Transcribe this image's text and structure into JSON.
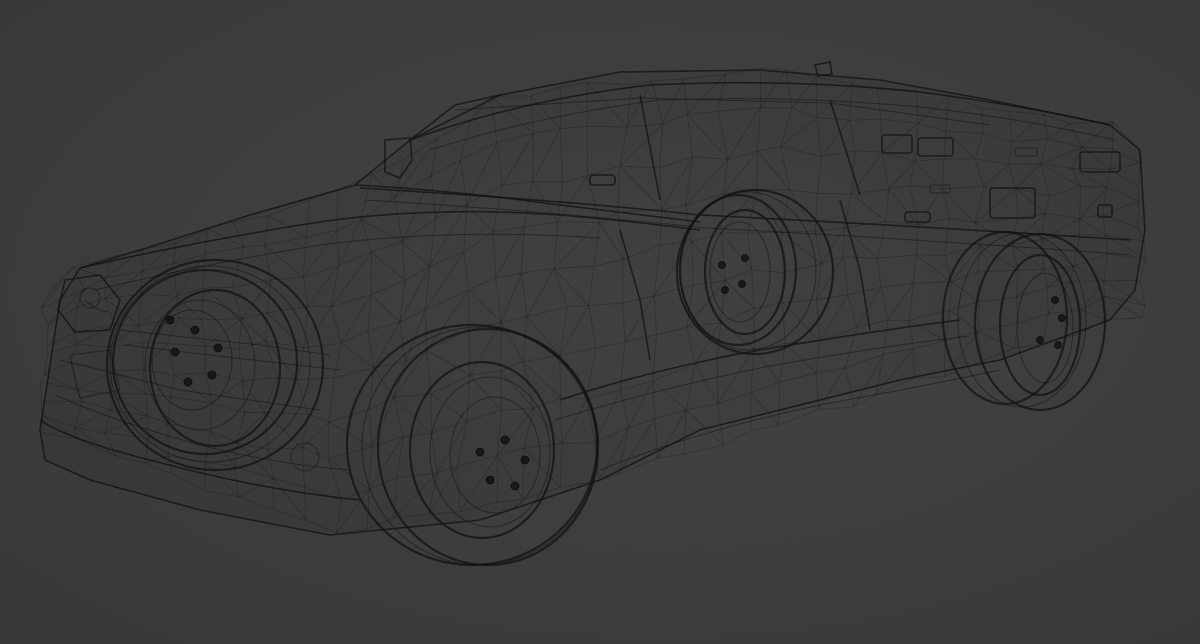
{
  "viewport": {
    "background_color": "#3d3d3d",
    "wire_color": "#141414",
    "display_mode": "wireframe"
  },
  "scene": {
    "object": "car-wireframe-model",
    "wheel_count": 4
  }
}
